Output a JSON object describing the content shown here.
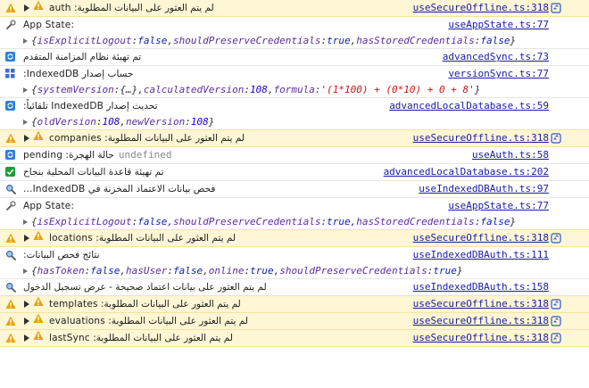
{
  "colors": {
    "warn_bg": "#fef6d5",
    "link": "#1a1aa6",
    "key": "#5a2d9c",
    "number": "#1c00cf",
    "string": "#c41a16",
    "keyword": "#0d22aa"
  },
  "rows": [
    {
      "kind": "warn",
      "icon": "warning-icon",
      "arrow": true,
      "emoji": "⚠️",
      "text": "لم يتم العثور على البيانات المطلوبة: auth",
      "src": "useSecureOffline.ts:318"
    },
    {
      "kind": "log",
      "icon": "wrench-icon",
      "text": "App State:",
      "src": "useAppState.ts:77",
      "detail": {
        "open": "{",
        "items": [
          [
            "isExplicitLogout",
            "false"
          ],
          [
            "shouldPreserveCredentials",
            "true"
          ],
          [
            "hasStoredCredentials",
            "false"
          ]
        ],
        "close": "}"
      }
    },
    {
      "kind": "log",
      "icon": "sync-icon",
      "text": "تم تهيئة نظام المزامنة المتقدم",
      "src": "advancedSync.ts:73"
    },
    {
      "kind": "log",
      "icon": "grid-icon",
      "text": "حساب إصدار IndexedDB:",
      "src": "versionSync.ts:77",
      "detail": {
        "open": "{",
        "items": [
          [
            "systemVersion",
            "{…}"
          ],
          [
            "calculatedVersion",
            "108"
          ],
          [
            "formula",
            "'(1*100) + (0*10) + 0 + 8'"
          ]
        ],
        "close": "}"
      }
    },
    {
      "kind": "log",
      "icon": "sync-icon",
      "text": "تحديث إصدار IndexedDB تلقائياً:",
      "src": "advancedLocalDatabase.ts:59",
      "detail": {
        "open": "{",
        "items": [
          [
            "oldVersion",
            "108"
          ],
          [
            "newVersion",
            "108"
          ]
        ],
        "close": "}"
      }
    },
    {
      "kind": "warn",
      "icon": "warning-icon",
      "arrow": true,
      "emoji": "⚠️",
      "text": "لم يتم العثور على البيانات المطلوبة: companies",
      "src": "useSecureOffline.ts:318"
    },
    {
      "kind": "log",
      "icon": "sync-icon",
      "text": "حالة الهجرة: pending",
      "extra": "undefined",
      "src": "useAuth.ts:58"
    },
    {
      "kind": "log",
      "icon": "check-icon",
      "text": "تم تهيئة قاعدة البيانات المحلية بنجاح",
      "src": "advancedLocalDatabase.ts:202"
    },
    {
      "kind": "log",
      "icon": "magnifier-icon",
      "text": "فحص بيانات الاعتماد المخزنة في IndexedDB...",
      "src": "useIndexedDBAuth.ts:97"
    },
    {
      "kind": "log",
      "icon": "wrench-icon",
      "text": "App State:",
      "src": "useAppState.ts:77",
      "detail": {
        "open": "{",
        "items": [
          [
            "isExplicitLogout",
            "false"
          ],
          [
            "shouldPreserveCredentials",
            "true"
          ],
          [
            "hasStoredCredentials",
            "false"
          ]
        ],
        "close": "}"
      }
    },
    {
      "kind": "warn",
      "icon": "warning-icon",
      "arrow": true,
      "emoji": "⚠️",
      "text": "لم يتم العثور على البيانات المطلوبة: locations",
      "src": "useSecureOffline.ts:318"
    },
    {
      "kind": "log",
      "icon": "magnifier-icon",
      "text": "نتائج فحص البيانات:",
      "src": "useIndexedDBAuth.ts:111",
      "detail": {
        "open": "{",
        "items": [
          [
            "hasToken",
            "false"
          ],
          [
            "hasUser",
            "false"
          ],
          [
            "online",
            "true"
          ],
          [
            "shouldPreserveCredentials",
            "true"
          ]
        ],
        "close": "}"
      }
    },
    {
      "kind": "log",
      "icon": "magnifier-icon",
      "text": "لم يتم العثور على بيانات اعتماد صحيحة - عرض تسجيل الدخول",
      "src": "useIndexedDBAuth.ts:158"
    },
    {
      "kind": "warn",
      "icon": "warning-icon",
      "arrow": true,
      "emoji": "⚠️",
      "text": "لم يتم العثور على البيانات المطلوبة: templates",
      "src": "useSecureOffline.ts:318"
    },
    {
      "kind": "warn",
      "icon": "warning-icon",
      "arrow": true,
      "emoji": "⚠️",
      "text": "لم يتم العثور على البيانات المطلوبة: evaluations",
      "src": "useSecureOffline.ts:318"
    },
    {
      "kind": "warn",
      "icon": "warning-icon",
      "arrow": true,
      "emoji": "⚠️",
      "text": "لم يتم العثور على البيانات المطلوبة: lastSync",
      "src": "useSecureOffline.ts:318"
    }
  ]
}
